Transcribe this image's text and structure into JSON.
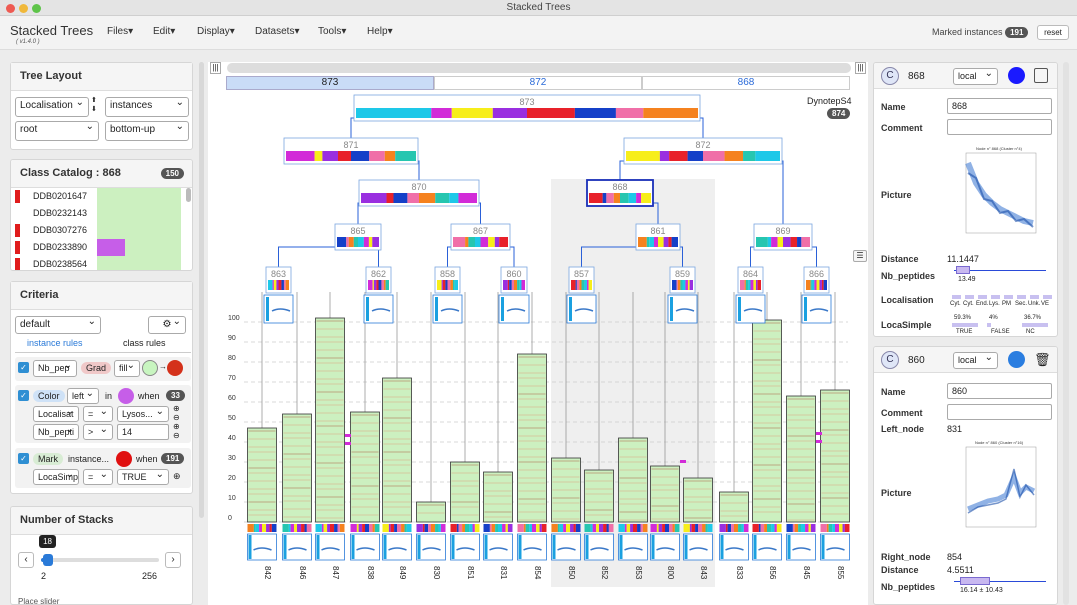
{
  "window": {
    "title": "Stacked Trees"
  },
  "app": {
    "name": "Stacked Trees",
    "version": "( v1.4.0 )"
  },
  "menu": [
    "Files",
    "Edit",
    "Display",
    "Datasets",
    "Tools",
    "Help"
  ],
  "marked": {
    "label": "Marked instances",
    "count": "191"
  },
  "reset_label": "reset",
  "tree_layout": {
    "title": "Tree Layout",
    "field1": "Localisation",
    "field2": "instances",
    "field3": "root",
    "field4": "bottom-up"
  },
  "class_catalog": {
    "title": "Class Catalog :",
    "class_id": "868",
    "count": "150",
    "rows": [
      {
        "name": "DDB0201647",
        "mark": "#e01c1c",
        "bar": 0
      },
      {
        "name": "DDB0232143",
        "mark": "",
        "bar": 0
      },
      {
        "name": "DDB0307276",
        "mark": "#e01c1c",
        "bar": 0
      },
      {
        "name": "DDB0233890",
        "mark": "#e01c1c",
        "bar": 0.33
      },
      {
        "name": "DDB0238564",
        "mark": "#e01c1c",
        "bar": 0
      }
    ]
  },
  "criteria": {
    "title": "Criteria",
    "preset": "default",
    "gear": "gear-icon",
    "tab_instance": "instance rules",
    "tab_class": "class rules",
    "rule1": {
      "attr": "Nb_pep",
      "mode": "Grad",
      "fill": "fill",
      "from_color": "#c8f5c0",
      "to_color": "#d4311a"
    },
    "rule2": {
      "type": "Color",
      "side": "left",
      "in": "in",
      "color": "#c65ee8",
      "when": "when",
      "count": "33",
      "cond1_attr": "Localisat",
      "cond1_op": "=",
      "cond1_val": "Lysos...",
      "cond2_attr": "Nb_pepti",
      "cond2_op": ">",
      "cond2_val": "14"
    },
    "rule3": {
      "type": "Mark",
      "target": "instance...",
      "color": "#e01010",
      "when": "when",
      "count": "191",
      "cond_attr": "LocaSimp",
      "cond_op": "=",
      "cond_val": "TRUE"
    }
  },
  "stacks": {
    "title": "Number of Stacks",
    "value": "18",
    "min": "2",
    "max": "256",
    "fraction": 0.06,
    "next_label": "Place slider"
  },
  "tabs": [
    "873",
    "872",
    "868"
  ],
  "dataset_name": "DynotepS4",
  "dataset_count": "874",
  "colors": {
    "orange": "#f5821f",
    "teal": "#26c6b0",
    "cyan": "#1ec8e8",
    "magenta": "#d22bd8",
    "yellow": "#f7ee1a",
    "purple": "#9a2fe0",
    "red": "#e8212a",
    "blue": "#1540c8",
    "green": "#8fd45c",
    "pink": "#f06fa8"
  },
  "tree_nodes": [
    "873",
    "871",
    "872",
    "870",
    "868",
    "865",
    "867",
    "861",
    "869",
    "863",
    "862",
    "858",
    "860",
    "857",
    "859",
    "864",
    "866"
  ],
  "chart_data": {
    "type": "bar",
    "categories": [
      "842",
      "846",
      "847",
      "838",
      "849",
      "830",
      "851",
      "831",
      "854",
      "850",
      "852",
      "853",
      "800",
      "843",
      "833",
      "856",
      "845",
      "855"
    ],
    "values": [
      47,
      54,
      102,
      55,
      72,
      10,
      30,
      25,
      84,
      32,
      26,
      42,
      28,
      22,
      15,
      101,
      63,
      66
    ],
    "ylim": [
      0,
      100
    ],
    "yticks": [
      0,
      10,
      20,
      30,
      40,
      50,
      60,
      70,
      80,
      90,
      100
    ]
  },
  "detail1": {
    "badge": "C",
    "id": "868",
    "scope": "local",
    "color": "#1a1aff",
    "name_label": "Name",
    "name_value": "868",
    "comment_label": "Comment",
    "comment_value": "",
    "picture_label": "Picture",
    "picture_title": "Node n° 868 (Cluster n°4)",
    "distance_label": "Distance",
    "distance_value": "11.1447",
    "nbpep_label": "Nb_peptides",
    "nbpep_value": "13.49",
    "loc_label": "Localisation",
    "loc_cats": [
      "Cyt.",
      "Cyt.",
      "End.",
      "Lys.",
      "PM",
      "Sec.",
      "Unk.",
      "VE"
    ],
    "locasimple_label": "LocaSimple",
    "locasimple": [
      {
        "pct": "59.3%",
        "cat": "TRUE"
      },
      {
        "pct": "4%",
        "cat": "FALSE"
      },
      {
        "pct": "36.7%",
        "cat": "NC"
      }
    ]
  },
  "detail2": {
    "badge": "C",
    "id": "860",
    "scope": "local",
    "color": "#2a7de0",
    "name_label": "Name",
    "name_value": "860",
    "comment_label": "Comment",
    "comment_value": "",
    "left_label": "Left_node",
    "left_value": "831",
    "picture_label": "Picture",
    "picture_title": "Node n° 860 (Cluster n°16)",
    "right_label": "Right_node",
    "right_value": "854",
    "distance_label": "Distance",
    "distance_value": "4.5511",
    "nbpep_label": "Nb_peptides",
    "nbpep_value": "16.14 ± 10.43"
  }
}
